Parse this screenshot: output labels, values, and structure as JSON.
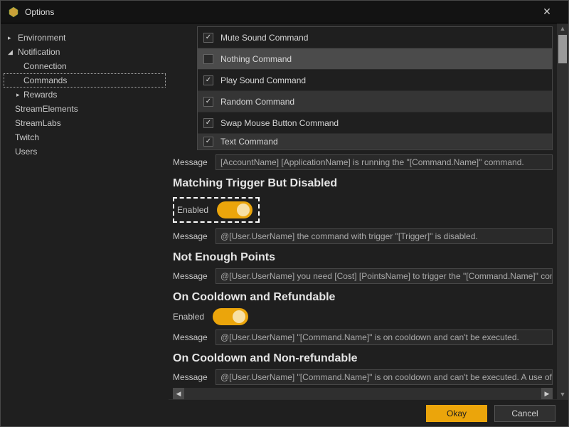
{
  "window": {
    "title": "Options",
    "close_glyph": "✕"
  },
  "sidebar": {
    "items": [
      {
        "label": "Environment",
        "arrow": "▸",
        "expanded": false
      },
      {
        "label": "Notification",
        "arrow": "◢",
        "expanded": true,
        "children": [
          {
            "label": "Connection"
          },
          {
            "label": "Commands",
            "selected": true
          },
          {
            "label": "Rewards",
            "arrow": "▸"
          }
        ]
      },
      {
        "label": "StreamElements"
      },
      {
        "label": "StreamLabs"
      },
      {
        "label": "Twitch"
      },
      {
        "label": "Users"
      }
    ]
  },
  "commands_list": [
    {
      "label": "Mute Sound Command",
      "checked": true
    },
    {
      "label": "Nothing Command",
      "checked": false,
      "selected": true
    },
    {
      "label": "Play Sound Command",
      "checked": true
    },
    {
      "label": "Random Command",
      "checked": true
    },
    {
      "label": "Swap Mouse Button Command",
      "checked": true
    },
    {
      "label": "Text Command",
      "checked": true,
      "partial": true
    }
  ],
  "top_message": {
    "label": "Message",
    "value": "[AccountName] [ApplicationName] is running the \"[Command.Name]\" command."
  },
  "sections": [
    {
      "heading": "Matching Trigger But Disabled",
      "enabled_label": "Enabled",
      "enabled": true,
      "highlighted": true,
      "message_label": "Message",
      "message_value": "@[User.UserName] the command with trigger \"[Trigger]\" is disabled."
    },
    {
      "heading": "Not Enough Points",
      "message_label": "Message",
      "message_value": "@[User.UserName] you need [Cost] [PointsName] to trigger the \"[Command.Name]\" command."
    },
    {
      "heading": "On Cooldown and Refundable",
      "enabled_label": "Enabled",
      "enabled": true,
      "message_label": "Message",
      "message_value": "@[User.UserName] \"[Command.Name]\" is on cooldown and can't be executed."
    },
    {
      "heading": "On Cooldown and Non-refundable",
      "message_label": "Message",
      "message_value": "@[User.UserName] \"[Command.Name]\" is on cooldown and can't be executed. A use of \"[Command.N"
    }
  ],
  "footer": {
    "okay": "Okay",
    "cancel": "Cancel"
  },
  "glyphs": {
    "check": "✓",
    "tri_right": "▸",
    "tri_down": "◢",
    "up": "▲",
    "down": "▼",
    "left": "◀",
    "right": "▶"
  }
}
